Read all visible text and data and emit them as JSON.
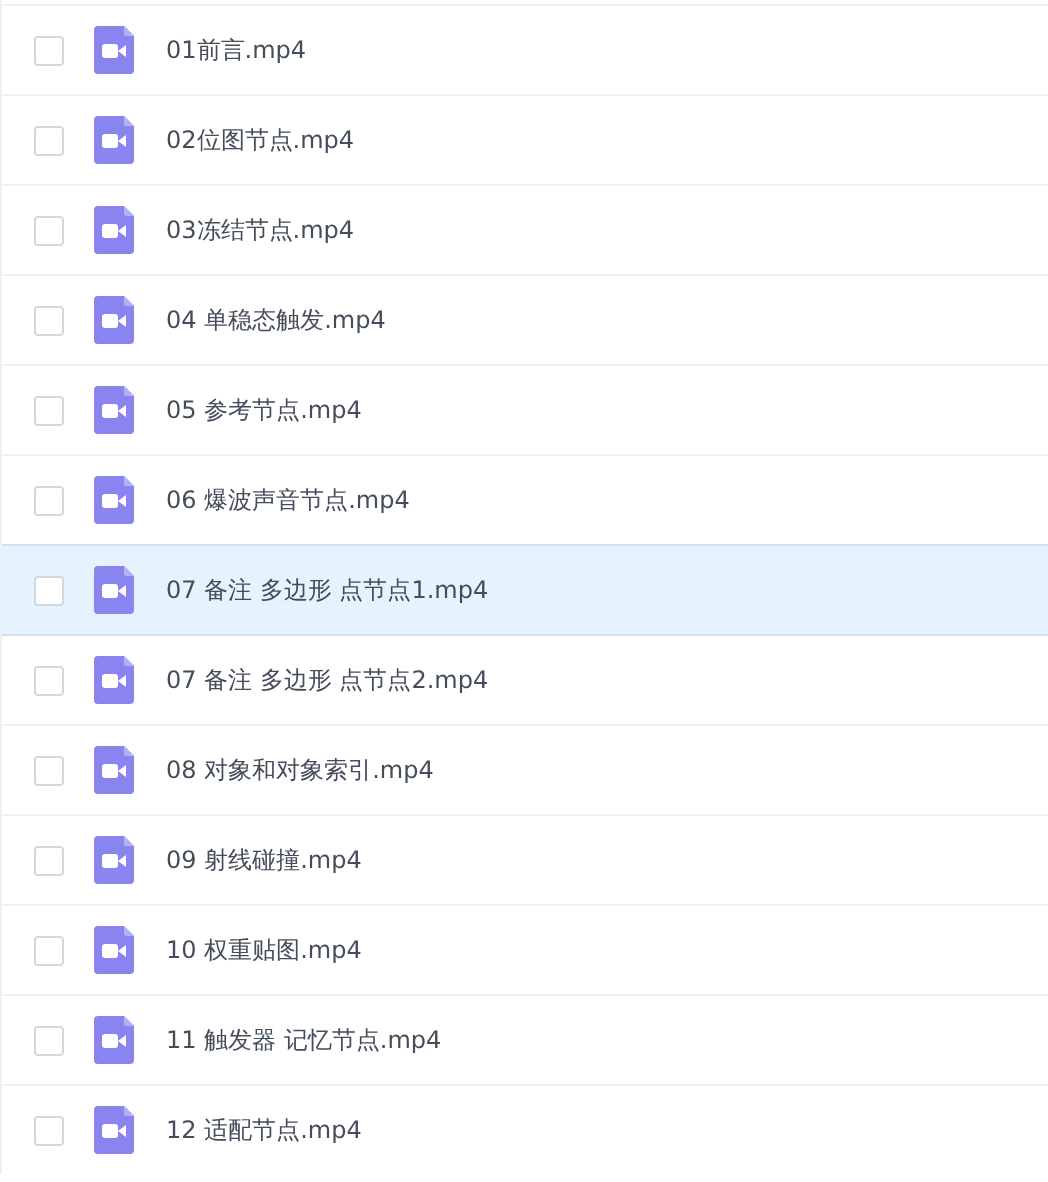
{
  "files": [
    {
      "name": "01前言.mp4",
      "checked": false,
      "selected": false
    },
    {
      "name": "02位图节点.mp4",
      "checked": false,
      "selected": false
    },
    {
      "name": "03冻结节点.mp4",
      "checked": false,
      "selected": false
    },
    {
      "name": "04 单稳态触发.mp4",
      "checked": false,
      "selected": false
    },
    {
      "name": "05 参考节点.mp4",
      "checked": false,
      "selected": false
    },
    {
      "name": "06 爆波声音节点.mp4",
      "checked": false,
      "selected": false
    },
    {
      "name": "07 备注 多边形 点节点1.mp4",
      "checked": false,
      "selected": true
    },
    {
      "name": "07 备注 多边形 点节点2.mp4",
      "checked": false,
      "selected": false
    },
    {
      "name": "08 对象和对象索引.mp4",
      "checked": false,
      "selected": false
    },
    {
      "name": "09 射线碰撞.mp4",
      "checked": false,
      "selected": false
    },
    {
      "name": "10 权重贴图.mp4",
      "checked": false,
      "selected": false
    },
    {
      "name": "11 触发器 记忆节点.mp4",
      "checked": false,
      "selected": false
    },
    {
      "name": "12 适配节点.mp4",
      "checked": false,
      "selected": false
    }
  ]
}
